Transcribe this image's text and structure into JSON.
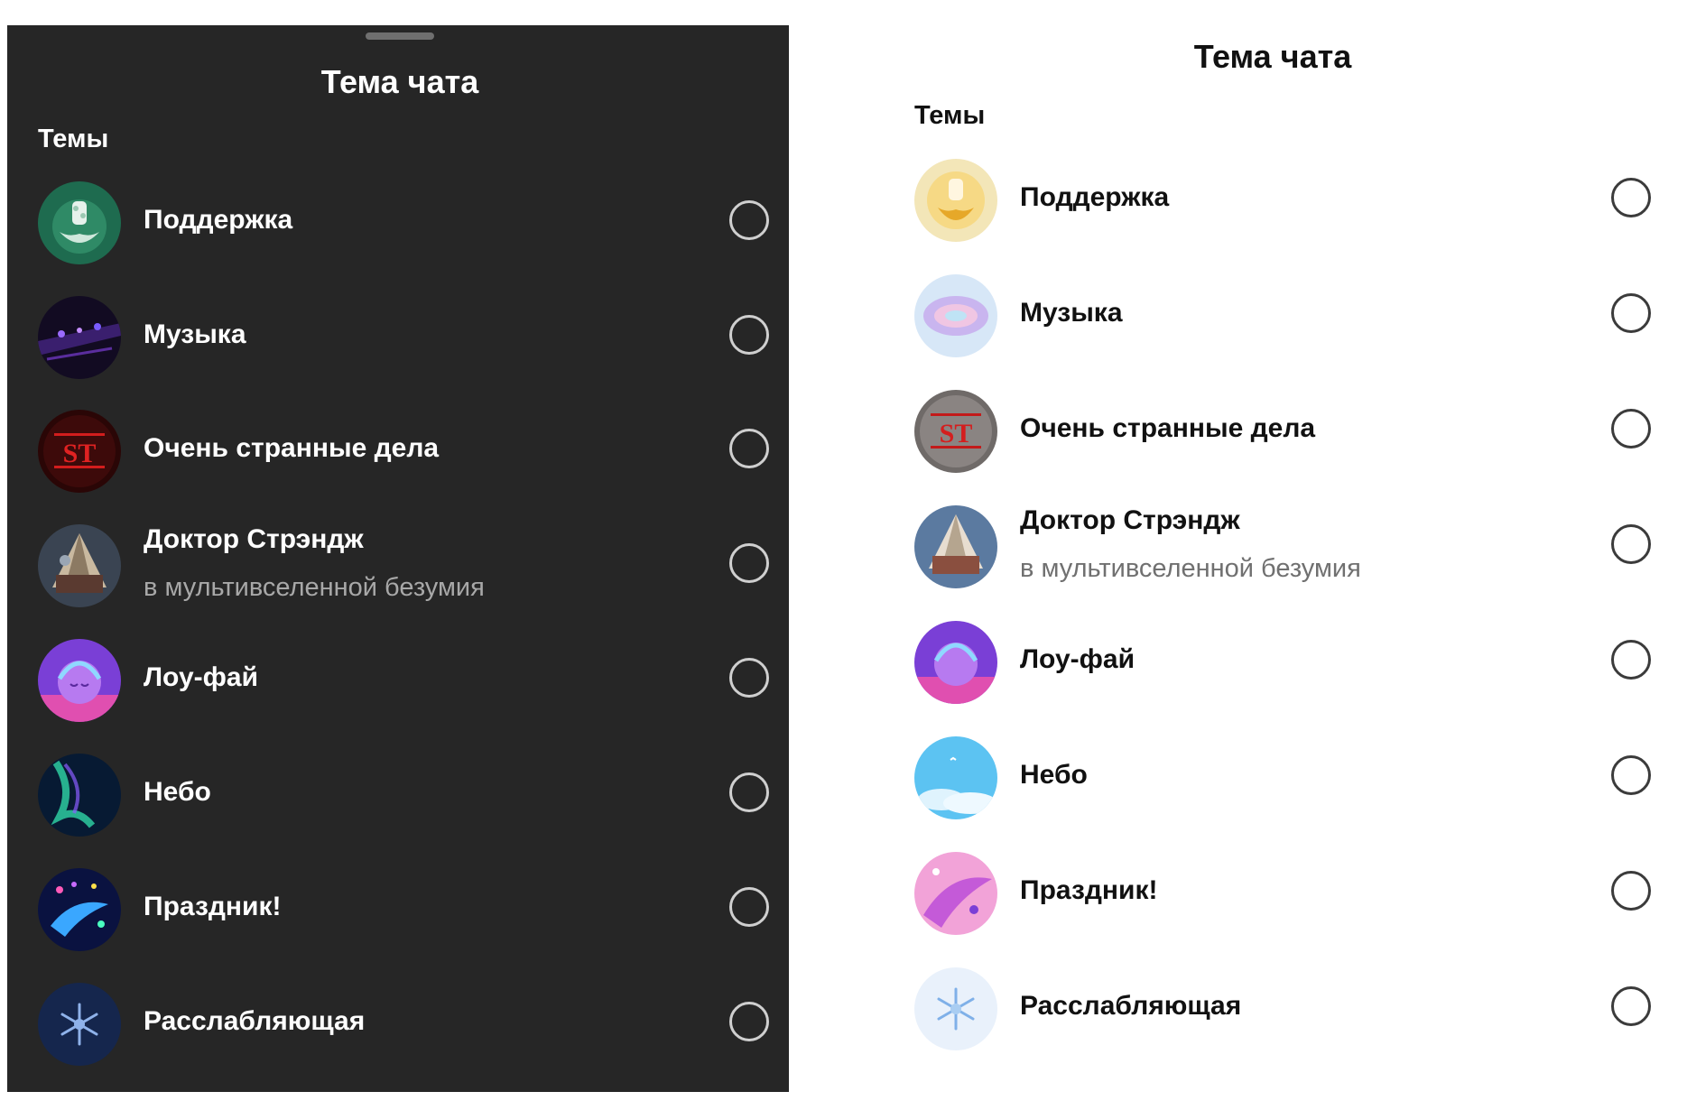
{
  "dark_panel": {
    "title": "Тема чата",
    "section_label": "Темы",
    "themes": [
      {
        "label": "Поддержка",
        "subtitle": "",
        "icon": "support-theme-icon"
      },
      {
        "label": "Музыка",
        "subtitle": "",
        "icon": "music-theme-icon"
      },
      {
        "label": "Очень странные дела",
        "subtitle": "",
        "icon": "stranger-things-theme-icon"
      },
      {
        "label": "Доктор Стрэндж",
        "subtitle": "в мультивселенной безумия",
        "icon": "doctor-strange-theme-icon"
      },
      {
        "label": "Лоу-фай",
        "subtitle": "",
        "icon": "lofi-theme-icon"
      },
      {
        "label": "Небо",
        "subtitle": "",
        "icon": "sky-theme-icon"
      },
      {
        "label": "Праздник!",
        "subtitle": "",
        "icon": "celebration-theme-icon"
      },
      {
        "label": "Расслабляющая",
        "subtitle": "",
        "icon": "relaxing-theme-icon"
      }
    ]
  },
  "light_panel": {
    "title": "Тема чата",
    "section_label": "Темы",
    "themes": [
      {
        "label": "Поддержка",
        "subtitle": "",
        "icon": "support-theme-icon"
      },
      {
        "label": "Музыка",
        "subtitle": "",
        "icon": "music-theme-icon"
      },
      {
        "label": "Очень странные дела",
        "subtitle": "",
        "icon": "stranger-things-theme-icon"
      },
      {
        "label": "Доктор Стрэндж",
        "subtitle": "в мультивселенной безумия",
        "icon": "doctor-strange-theme-icon"
      },
      {
        "label": "Лоу-фай",
        "subtitle": "",
        "icon": "lofi-theme-icon"
      },
      {
        "label": "Небо",
        "subtitle": "",
        "icon": "sky-theme-icon"
      },
      {
        "label": "Праздник!",
        "subtitle": "",
        "icon": "celebration-theme-icon"
      },
      {
        "label": "Расслабляющая",
        "subtitle": "",
        "icon": "relaxing-theme-icon"
      }
    ]
  },
  "colors": {
    "dark_background": "#262626",
    "light_background": "#ffffff",
    "dark_text": "#ffffff",
    "light_text": "#111111",
    "dark_subtext": "#a8a8a8",
    "light_subtext": "#707070"
  }
}
